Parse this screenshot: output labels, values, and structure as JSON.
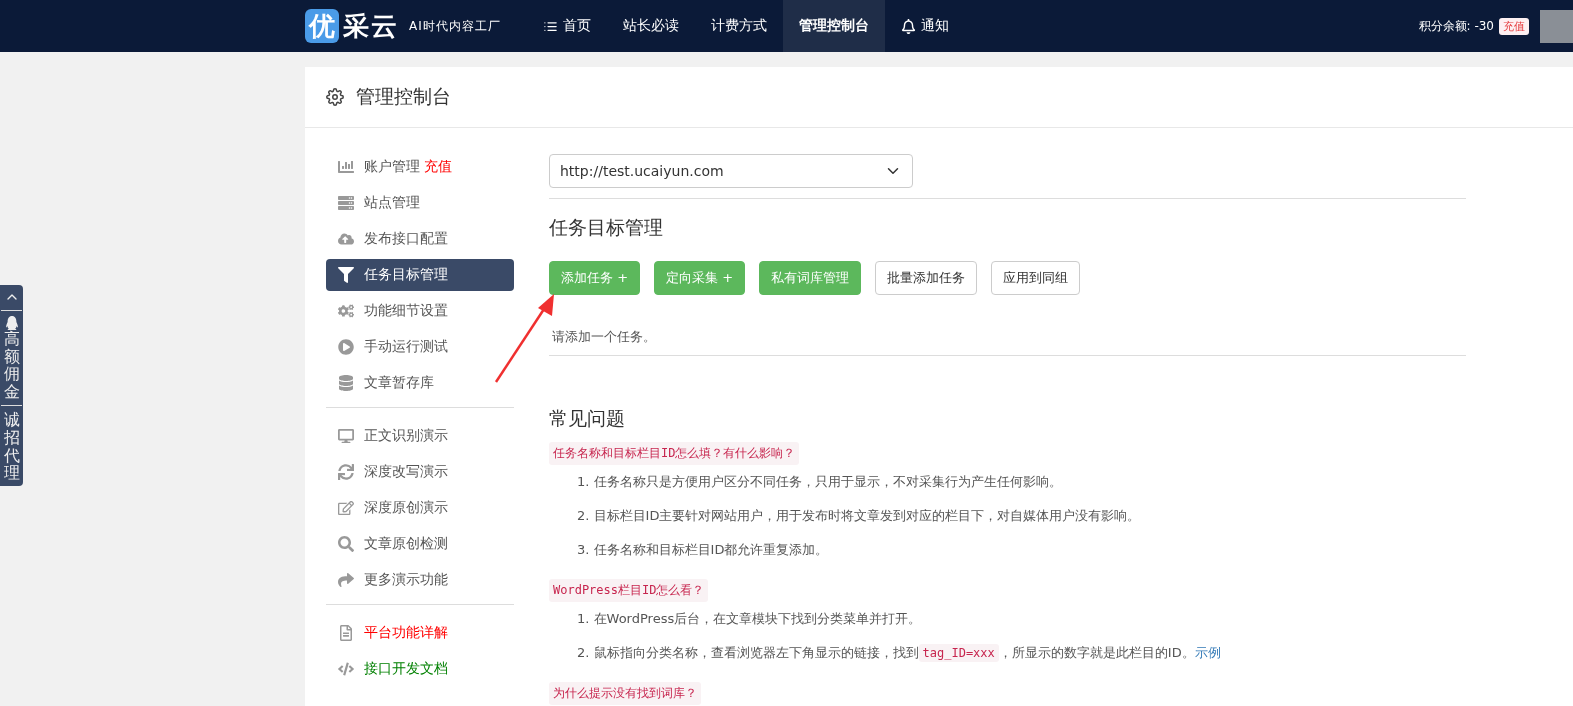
{
  "header": {
    "logo": {
      "mark": "优",
      "name": "采云",
      "slogan": "AI时代内容工厂"
    },
    "nav": [
      {
        "label": "首页",
        "selected": false
      },
      {
        "label": "站长必读",
        "selected": false
      },
      {
        "label": "计费方式",
        "selected": false
      },
      {
        "label": "管理控制台",
        "selected": true
      },
      {
        "label": "通知",
        "selected": false
      }
    ],
    "balance": "积分余额: -30",
    "recharge": "充值"
  },
  "side_tab": {
    "groups": [
      "高额佣金",
      "诚招代理"
    ]
  },
  "panel": {
    "title": "管理控制台"
  },
  "sidebar": {
    "groups": [
      [
        {
          "label": "账户管理",
          "badge": "充值",
          "selected": false
        },
        {
          "label": "站点管理",
          "selected": false
        },
        {
          "label": "发布接口配置",
          "selected": false
        },
        {
          "label": "任务目标管理",
          "selected": true
        },
        {
          "label": "功能细节设置",
          "selected": false
        },
        {
          "label": "手动运行测试",
          "selected": false
        },
        {
          "label": "文章暂存库",
          "selected": false
        }
      ],
      [
        {
          "label": "正文识别演示",
          "selected": false
        },
        {
          "label": "深度改写演示",
          "selected": false
        },
        {
          "label": "深度原创演示",
          "selected": false
        },
        {
          "label": "文章原创检测",
          "selected": false
        },
        {
          "label": "更多演示功能",
          "selected": false
        }
      ],
      [
        {
          "label": "平台功能详解",
          "selected": false,
          "color": "#ff0000"
        },
        {
          "label": "接口开发文档",
          "selected": false,
          "color": "#008000"
        }
      ]
    ]
  },
  "site_select": {
    "value": "http://test.ucaiyun.com"
  },
  "task_section": {
    "title": "任务目标管理",
    "buttons": [
      {
        "label": "添加任务 +",
        "kind": "primary"
      },
      {
        "label": "定向采集 +",
        "kind": "primary"
      },
      {
        "label": "私有词库管理",
        "kind": "primary"
      },
      {
        "label": "批量添加任务",
        "kind": "default"
      },
      {
        "label": "应用到同组",
        "kind": "default"
      }
    ],
    "empty_message": "请添加一个任务。"
  },
  "faq": {
    "title": "常见问题",
    "items": [
      {
        "question": "任务名称和目标栏目ID怎么填？有什么影响？",
        "answers": [
          {
            "number": "1.",
            "parts": [
              {
                "kind": "text",
                "text": "任务名称只是方便用户区分不同任务，只用于显示，不对采集行为产生任何影响。"
              }
            ]
          },
          {
            "number": "2.",
            "parts": [
              {
                "kind": "text",
                "text": "目标栏目ID主要针对网站用户，用于发布时将文章发到对应的栏目下，对自媒体用户没有影响。"
              }
            ]
          },
          {
            "number": "3.",
            "parts": [
              {
                "kind": "text",
                "text": "任务名称和目标栏目ID都允许重复添加。"
              }
            ]
          }
        ]
      },
      {
        "question": "WordPress栏目ID怎么看？",
        "answers": [
          {
            "number": "1.",
            "parts": [
              {
                "kind": "text",
                "text": "在WordPress后台，在文章模块下找到分类菜单并打开。"
              }
            ]
          },
          {
            "number": "2.",
            "parts": [
              {
                "kind": "text",
                "text": "鼠标指向分类名称，查看浏览器左下角显示的链接，找到"
              },
              {
                "kind": "code",
                "text": "tag_ID=xxx"
              },
              {
                "kind": "text",
                "text": "，所显示的数字就是此栏目的ID。"
              },
              {
                "kind": "link",
                "text": "示例"
              }
            ]
          }
        ]
      },
      {
        "question": "为什么提示没有找到词库？"
      }
    ]
  }
}
